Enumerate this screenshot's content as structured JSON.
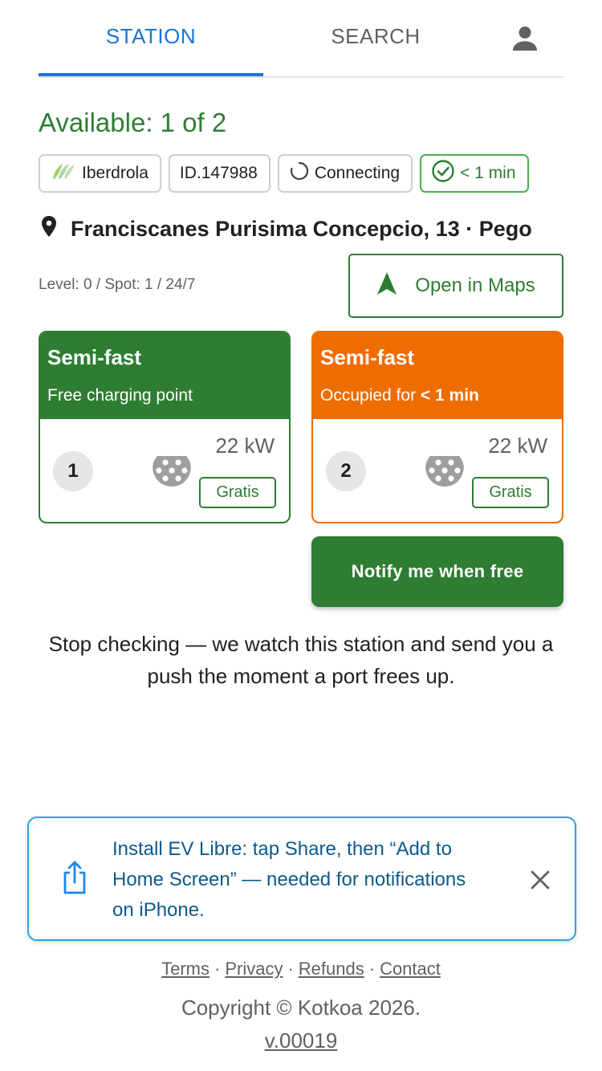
{
  "tabs": [
    {
      "label": "STATION",
      "active": true
    },
    {
      "label": "SEARCH",
      "active": false
    }
  ],
  "profile_icon": "person-icon",
  "availability": "Available: 1 of 2",
  "chips": {
    "operator": "Iberdrola",
    "id": "ID.147988",
    "status": "Connecting",
    "freshness": "< 1 min"
  },
  "address": "Franciscanes Purisima Concepcio, 13 · Pego",
  "level_info": "Level: 0 / Spot: 1 / 24/7",
  "maps_button": "Open in Maps",
  "ports": [
    {
      "title": "Semi-fast",
      "subtitle": "Free charging point",
      "subtitle_prefix": "",
      "subtitle_bold": "",
      "number": "1",
      "power": "22 kW",
      "price": "Gratis",
      "color": "#2e7d32"
    },
    {
      "title": "Semi-fast",
      "subtitle": "",
      "subtitle_prefix": "Occupied for",
      "subtitle_bold": "< 1 min",
      "number": "2",
      "power": "22 kW",
      "price": "Gratis",
      "color": "#ef6c00"
    }
  ],
  "notify_button": "Notify me when free",
  "notify_description": "Stop checking — we watch this station and send you a push the moment a port frees up.",
  "install_banner": {
    "text": "Install EV Libre: tap Share, then “Add to Home Screen” — needed for notifications on iPhone.",
    "share_icon": "share-icon",
    "close_icon": "close-icon"
  },
  "footer": {
    "links": [
      "Terms",
      "Privacy",
      "Refunds",
      "Contact"
    ],
    "separator": "·",
    "copyright": "Copyright © Kotkoa 2026.",
    "version": "v.00019"
  },
  "colors": {
    "accent_blue": "#1976d2",
    "available_green": "#2e7d32",
    "occupied_orange": "#ef6c00",
    "banner_border": "#29a6dc"
  }
}
